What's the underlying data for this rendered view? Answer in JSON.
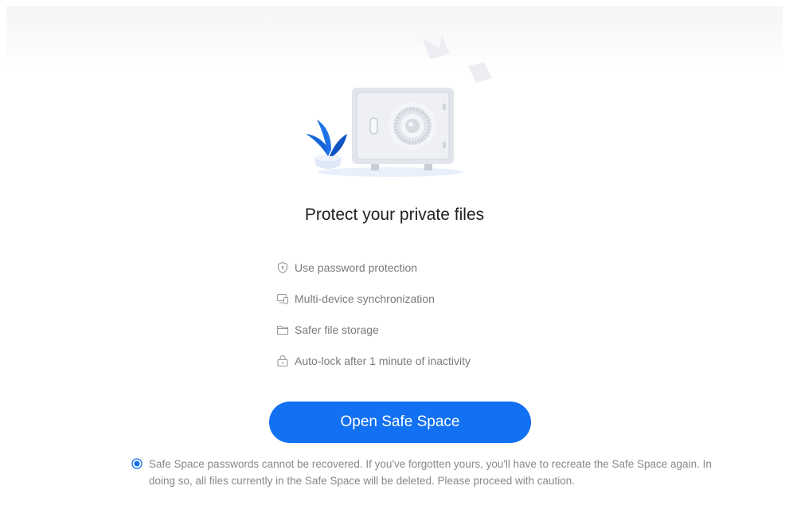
{
  "title": "Protect your private files",
  "features": [
    {
      "icon": "shield-icon",
      "label": "Use password protection"
    },
    {
      "icon": "devices-icon",
      "label": "Multi-device synchronization"
    },
    {
      "icon": "folder-icon",
      "label": "Safer file storage"
    },
    {
      "icon": "lock-icon",
      "label": "Auto-lock after 1 minute of inactivity"
    }
  ],
  "open_button_label": "Open Safe Space",
  "notice": {
    "selected": true,
    "text": "Safe Space passwords cannot be recovered. If you've forgotten yours, you'll have to recreate the Safe Space again. In doing so, all files currently in the Safe Space will be deleted. Please proceed with caution."
  },
  "colors": {
    "accent": "#1271f2",
    "muted_text": "#888888"
  }
}
